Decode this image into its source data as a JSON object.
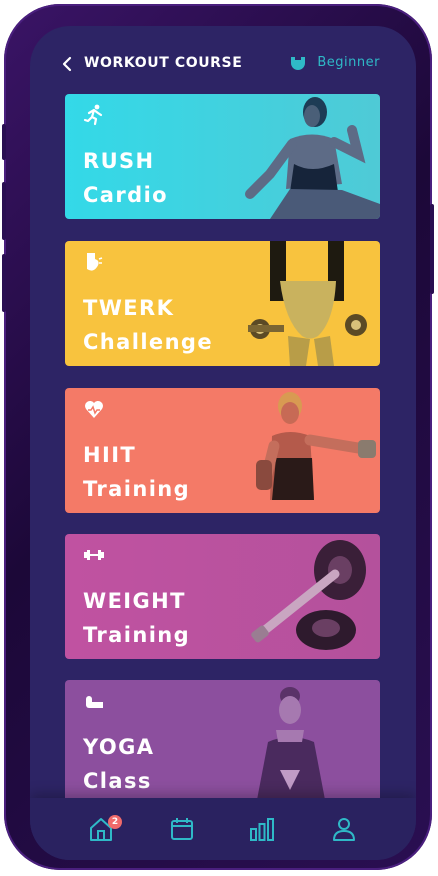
{
  "header": {
    "title": "WORKOUT COURSE",
    "level": "Beginner",
    "accent": "#2fb9c7"
  },
  "cards": [
    {
      "line1": "RUSH",
      "line2": "Cardio",
      "color": "#3dd6de",
      "icon": "runner-icon"
    },
    {
      "line1": "TWERK",
      "line2": "Challenge",
      "color": "#f8c33e",
      "icon": "glute-icon"
    },
    {
      "line1": "HIIT",
      "line2": "Training",
      "color": "#f47a67",
      "icon": "heart-rate-icon"
    },
    {
      "line1": "WEIGHT",
      "line2": "Training",
      "color": "#c052a1",
      "icon": "dumbbell-icon"
    },
    {
      "line1": "YOGA",
      "line2": "Class",
      "color": "#8c4f9e",
      "icon": "yoga-mat-icon"
    }
  ],
  "nav": {
    "home_badge": "2",
    "items": [
      "home-icon",
      "calendar-icon",
      "stats-icon",
      "profile-icon"
    ]
  }
}
